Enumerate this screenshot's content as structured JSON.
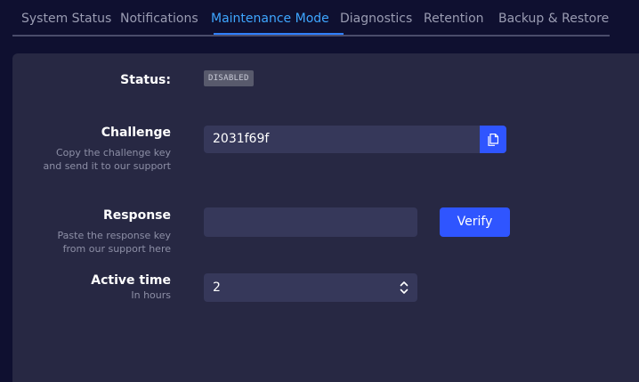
{
  "tabs": [
    {
      "label": "System Status"
    },
    {
      "label": "Notifications"
    },
    {
      "label": "Maintenance Mode"
    },
    {
      "label": "Diagnostics"
    },
    {
      "label": "Retention"
    },
    {
      "label": "Backup & Restore"
    }
  ],
  "active_tab": "Maintenance Mode",
  "form": {
    "status": {
      "label": "Status:",
      "value": "DISABLED"
    },
    "challenge": {
      "label": "Challenge",
      "hint_line1": "Copy the challenge key",
      "hint_line2": "and send it to our support",
      "value": "2031f69f",
      "copy_icon": "copy-icon"
    },
    "response": {
      "label": "Response",
      "hint_line1": "Paste the response key",
      "hint_line2": "from our support here",
      "value": "",
      "verify_label": "Verify"
    },
    "active_time": {
      "label": "Active time",
      "hint": "In hours",
      "value": "2"
    }
  },
  "colors": {
    "background": "#0f1030",
    "panel": "#272843",
    "input": "#36385a",
    "accent": "#2f55ff",
    "active_tab": "#3ea6ff"
  }
}
